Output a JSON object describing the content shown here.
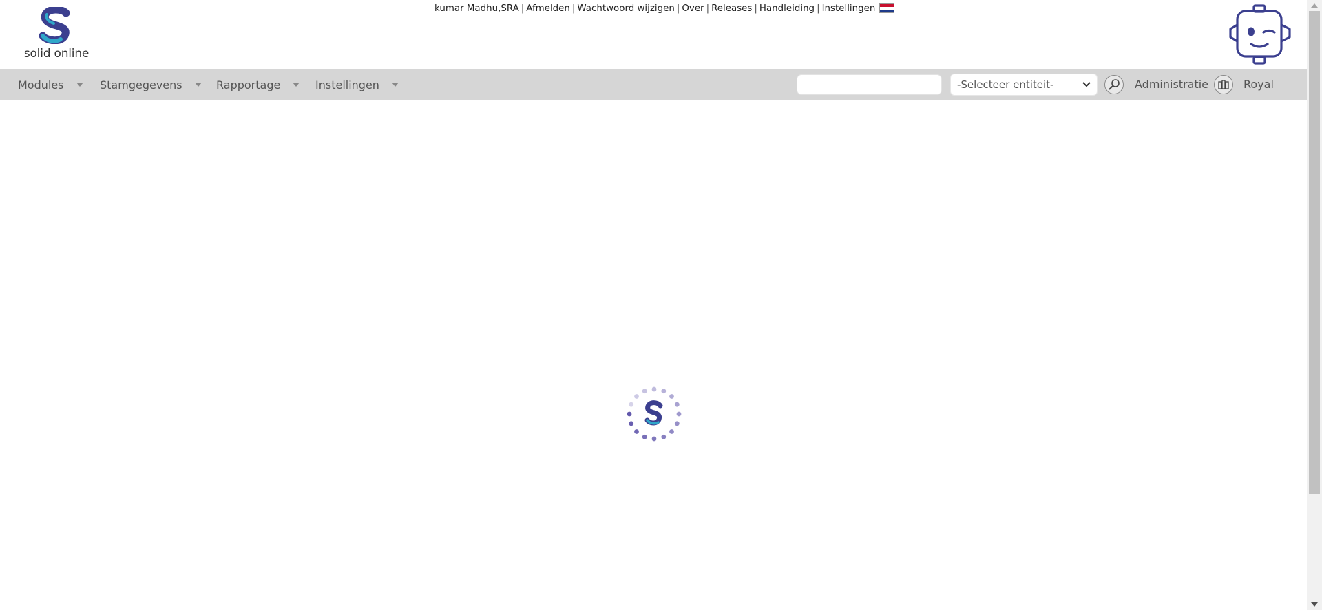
{
  "brand": {
    "name": "solid online"
  },
  "top_links": {
    "user": "kumar Madhu,SRA",
    "logout": "Afmelden",
    "change_password": "Wachtwoord wijzigen",
    "about": "Over",
    "releases": "Releases",
    "manual": "Handleiding",
    "settings": "Instellingen",
    "language_flag": "flag-nl-icon"
  },
  "nav": {
    "menus": [
      "Modules",
      "Stamgegevens",
      "Rapportage",
      "Instellingen"
    ],
    "search": {
      "value": "",
      "placeholder": ""
    },
    "entity_select": {
      "selected": "-Selecteer entiteit-"
    },
    "administration_label": "Administratie",
    "company_label": "Royal"
  },
  "icons": [
    "search-icon",
    "building-icon",
    "robot-assistant-icon",
    "loading-spinner-icon",
    "chevron-down-icon"
  ],
  "colors": {
    "navbar_bg": "#d6d6d6",
    "logout_link": "#1a8a1a",
    "brand_primary": "#3b3f8f",
    "brand_accent": "#2fa7c9"
  }
}
